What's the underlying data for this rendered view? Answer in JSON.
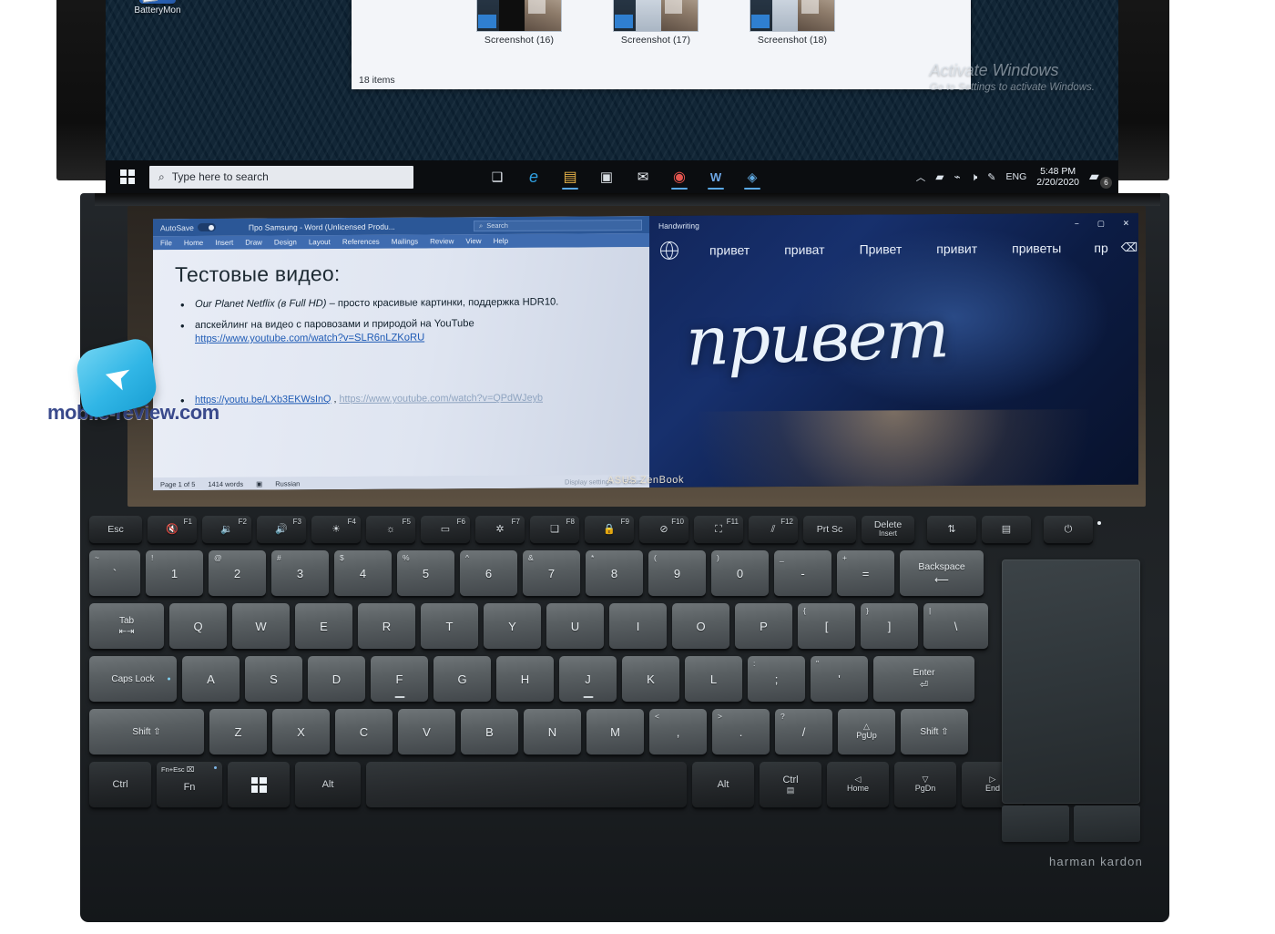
{
  "device": {
    "brand_screenpad": "ASUS ZenBook",
    "brand_audio": "harman  kardon"
  },
  "watermark": {
    "text": "mobile-review.com",
    "logo_icon": "cursor-arrow-icon"
  },
  "main_display": {
    "desktop_icon": {
      "label": "BatteryMon",
      "icon": "batterymon-icon"
    },
    "explorer": {
      "status": "18 items",
      "files": [
        {
          "label": "Screenshot (16)"
        },
        {
          "label": "Screenshot (17)"
        },
        {
          "label": "Screenshot (18)"
        }
      ]
    },
    "watermark": {
      "line1": "Activate Windows",
      "line2": "Go to Settings to activate Windows."
    },
    "taskbar": {
      "start_icon": "windows-logo-icon",
      "search_placeholder": "Type here to search",
      "search_icon": "search-icon",
      "apps": [
        {
          "name": "task-view-icon",
          "glyph": "❑"
        },
        {
          "name": "edge-icon",
          "glyph": "e"
        },
        {
          "name": "file-explorer-icon",
          "glyph": "▤"
        },
        {
          "name": "microsoft-store-icon",
          "glyph": "▣"
        },
        {
          "name": "mail-icon",
          "glyph": "✉"
        },
        {
          "name": "chrome-icon",
          "glyph": "◉"
        },
        {
          "name": "word-icon",
          "glyph": "W"
        },
        {
          "name": "myasus-icon",
          "glyph": "◈"
        }
      ],
      "tray": {
        "chevron": "︿",
        "battery_icon": "battery-icon",
        "wifi_icon": "wifi-icon",
        "volume_icon": "volume-muted-icon",
        "pen_icon": "pen-icon",
        "language": "ENG",
        "time": "5:48 PM",
        "date": "2/20/2020",
        "notifications_icon": "notification-icon",
        "notifications_count": "6"
      }
    }
  },
  "screenpad": {
    "word": {
      "autosave_label": "AutoSave",
      "autosave_state": "On",
      "document_title": "Про Samsung  -  Word (Unlicensed Produ...",
      "search_placeholder": "Search",
      "search_icon": "search-icon",
      "ribbon_tabs": [
        "File",
        "Home",
        "Insert",
        "Draw",
        "Design",
        "Layout",
        "References",
        "Mailings",
        "Review",
        "View",
        "Help"
      ],
      "doc_heading": "Тестовые видео:",
      "doc_items": [
        {
          "em": "Our Planet Netflix (в Full HD)",
          "rest": " – просто красивые картинки, поддержка HDR10."
        }
      ],
      "doc_item2_text": "апскейлинг на видео с паровозами и природой на YouTube",
      "doc_item2_link": "https://www.youtube.com/watch?v=SLR6nLZKoRU",
      "doc_item3_link_a": "https://youtu.be/LXb3EKWsInQ",
      "doc_item3_sep": " , ",
      "doc_item3_link_b": "https://www.youtube.com/watch?v=QPdWJeyb",
      "status": {
        "page": "Page 1 of 5",
        "words": "1414 words",
        "proofing_icon": "proofing-icon",
        "language": "Russian",
        "display_settings": "Display settings",
        "focus": "Focus"
      }
    },
    "handwriting": {
      "title": "Handwriting",
      "minimize_icon": "minimize-icon",
      "maximize_icon": "maximize-icon",
      "close_icon": "close-icon",
      "language_icon": "globe-icon",
      "suggestions": [
        "привет",
        "приват",
        "Привет",
        "привит",
        "приветы",
        "пр"
      ],
      "backspace_icon": "backspace-icon",
      "ink_text": "привет"
    }
  },
  "keyboard": {
    "row_fn": [
      {
        "name": "esc-key",
        "main": "Esc"
      },
      {
        "name": "f1-key",
        "tr": "F1",
        "icon": "🔇"
      },
      {
        "name": "f2-key",
        "tr": "F2",
        "icon": "🔉"
      },
      {
        "name": "f3-key",
        "tr": "F3",
        "icon": "🔊"
      },
      {
        "name": "f4-key",
        "tr": "F4",
        "icon": "☀"
      },
      {
        "name": "f5-key",
        "tr": "F5",
        "icon": "☼"
      },
      {
        "name": "f6-key",
        "tr": "F6",
        "icon": "▭"
      },
      {
        "name": "f7-key",
        "tr": "F7",
        "icon": "✲"
      },
      {
        "name": "f8-key",
        "tr": "F8",
        "icon": "❏"
      },
      {
        "name": "f9-key",
        "tr": "F9",
        "icon": "🔒"
      },
      {
        "name": "f10-key",
        "tr": "F10",
        "icon": "⊘"
      },
      {
        "name": "f11-key",
        "tr": "F11",
        "icon": "⛶"
      },
      {
        "name": "f12-key",
        "tr": "F12",
        "icon": "⫽"
      },
      {
        "name": "print-screen-key",
        "main": "Prt Sc"
      },
      {
        "name": "delete-key",
        "main": "Delete",
        "sub": "Insert"
      },
      {
        "name": "screen-swap-key",
        "icon": "⇅"
      },
      {
        "name": "screenpad-toggle-key",
        "icon": "▤"
      },
      {
        "name": "power-key",
        "icon": "⏻"
      }
    ],
    "row_num": [
      {
        "name": "tilde-key",
        "tl": "~",
        "main": "`"
      },
      {
        "name": "1-key",
        "tl": "!",
        "main": "1"
      },
      {
        "name": "2-key",
        "tl": "@",
        "main": "2"
      },
      {
        "name": "3-key",
        "tl": "#",
        "main": "3"
      },
      {
        "name": "4-key",
        "tl": "$",
        "main": "4"
      },
      {
        "name": "5-key",
        "tl": "%",
        "main": "5"
      },
      {
        "name": "6-key",
        "tl": "^",
        "main": "6"
      },
      {
        "name": "7-key",
        "tl": "&",
        "main": "7"
      },
      {
        "name": "8-key",
        "tl": "*",
        "main": "8"
      },
      {
        "name": "9-key",
        "tl": "(",
        "main": "9"
      },
      {
        "name": "0-key",
        "tl": ")",
        "main": "0"
      },
      {
        "name": "minus-key",
        "tl": "_",
        "main": "-"
      },
      {
        "name": "equals-key",
        "tl": "+",
        "main": "="
      },
      {
        "name": "backspace-key",
        "main": "Backspace",
        "sub": "⟵"
      }
    ],
    "row_q": [
      {
        "name": "tab-key",
        "main": "Tab",
        "sub": "⇤⇥"
      },
      {
        "name": "q-key",
        "main": "Q"
      },
      {
        "name": "w-key",
        "main": "W"
      },
      {
        "name": "e-key",
        "main": "E"
      },
      {
        "name": "r-key",
        "main": "R"
      },
      {
        "name": "t-key",
        "main": "T"
      },
      {
        "name": "y-key",
        "main": "Y"
      },
      {
        "name": "u-key",
        "main": "U"
      },
      {
        "name": "i-key",
        "main": "I"
      },
      {
        "name": "o-key",
        "main": "O"
      },
      {
        "name": "p-key",
        "main": "P"
      },
      {
        "name": "bracket-left-key",
        "tl": "{",
        "main": "["
      },
      {
        "name": "bracket-right-key",
        "tl": "}",
        "main": "]"
      },
      {
        "name": "backslash-key",
        "tl": "|",
        "main": "\\"
      }
    ],
    "row_a": [
      {
        "name": "caps-lock-key",
        "main": "Caps Lock"
      },
      {
        "name": "a-key",
        "main": "A"
      },
      {
        "name": "s-key",
        "main": "S"
      },
      {
        "name": "d-key",
        "main": "D"
      },
      {
        "name": "f-key",
        "main": "F"
      },
      {
        "name": "g-key",
        "main": "G"
      },
      {
        "name": "h-key",
        "main": "H"
      },
      {
        "name": "j-key",
        "main": "J"
      },
      {
        "name": "k-key",
        "main": "K"
      },
      {
        "name": "l-key",
        "main": "L"
      },
      {
        "name": "semicolon-key",
        "tl": ":",
        "main": ";"
      },
      {
        "name": "quote-key",
        "tl": "\"",
        "main": "'"
      },
      {
        "name": "enter-key",
        "main": "Enter",
        "sub": "⏎"
      }
    ],
    "row_z": [
      {
        "name": "shift-left-key",
        "main": "Shift ⇧"
      },
      {
        "name": "z-key",
        "main": "Z"
      },
      {
        "name": "x-key",
        "main": "X"
      },
      {
        "name": "c-key",
        "main": "C"
      },
      {
        "name": "v-key",
        "main": "V"
      },
      {
        "name": "b-key",
        "main": "B"
      },
      {
        "name": "n-key",
        "main": "N"
      },
      {
        "name": "m-key",
        "main": "M"
      },
      {
        "name": "comma-key",
        "tl": "<",
        "main": ","
      },
      {
        "name": "period-key",
        "tl": ">",
        "main": "."
      },
      {
        "name": "slash-key",
        "tl": "?",
        "main": "/"
      },
      {
        "name": "arrow-up-key",
        "ar": "△",
        "nm": "PgUp"
      },
      {
        "name": "shift-right-key",
        "main": "Shift ⇧"
      }
    ],
    "row_space": [
      {
        "name": "ctrl-left-key",
        "main": "Ctrl"
      },
      {
        "name": "fn-key",
        "tl": "Fn+Esc ⌧",
        "main": "Fn"
      },
      {
        "name": "windows-key",
        "icon": "⊞"
      },
      {
        "name": "alt-left-key",
        "main": "Alt"
      },
      {
        "name": "space-key",
        "main": ""
      },
      {
        "name": "alt-right-key",
        "main": "Alt"
      },
      {
        "name": "ctrl-right-key",
        "main": "Ctrl",
        "sub": "▤"
      },
      {
        "name": "arrow-left-key",
        "ar": "◁",
        "nm": "Home"
      },
      {
        "name": "arrow-down-key",
        "ar": "▽",
        "nm": "PgDn"
      },
      {
        "name": "arrow-right-key",
        "ar": "▷",
        "nm": "End"
      }
    ]
  }
}
